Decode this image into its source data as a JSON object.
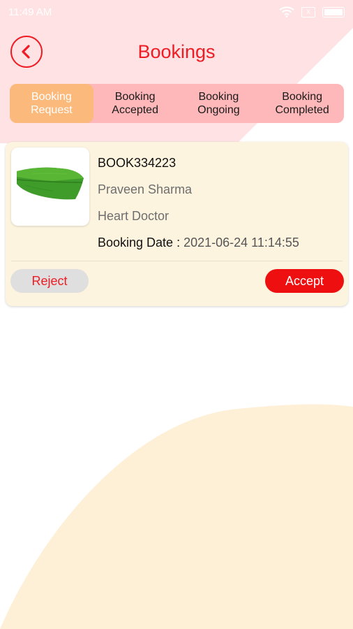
{
  "status_bar": {
    "time": "11:49 AM",
    "sim_label": "X",
    "icons": [
      "wifi-icon",
      "sim-icon",
      "battery-icon"
    ]
  },
  "header": {
    "title": "Bookings",
    "back_icon": "chevron-left-icon"
  },
  "tabs": [
    {
      "label": "Booking\nRequest",
      "active": true
    },
    {
      "label": "Booking\nAccepted",
      "active": false
    },
    {
      "label": "Booking\nOngoing",
      "active": false
    },
    {
      "label": "Booking\nCompleted",
      "active": false
    }
  ],
  "bookings": [
    {
      "image": "banana-leaf",
      "booking_id": "BOOK334223",
      "name": "Praveen Sharma",
      "specialty": "Heart Doctor",
      "date_label": "Booking Date : ",
      "date_value": "2021-06-24 11:14:55",
      "reject_label": "Reject",
      "accept_label": "Accept"
    }
  ],
  "colors": {
    "accent": "#ee1d25",
    "tab_bg": "#ffb8ba",
    "tab_active": "#fcb97c",
    "card_bg": "#fdf4df",
    "top_bg": "#ffe2e3",
    "bottom_bg": "#fdf0d6"
  }
}
